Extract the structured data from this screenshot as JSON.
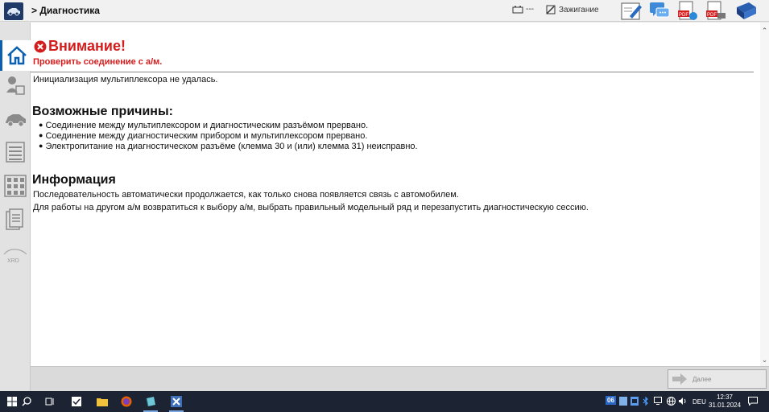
{
  "header": {
    "breadcrumb": "> Диагностика",
    "connection_value": "---",
    "ignition_label": "Зажигание"
  },
  "alert": {
    "title": "Внимание!",
    "subtitle": "Проверить соединение с а/м.",
    "message": "Инициализация мультиплексора не удалась."
  },
  "causes": {
    "heading": "Возможные причины:",
    "items": [
      "Соединение между мультиплексором и диагностическим разъёмом прервано.",
      "Соединение между диагностическим прибором и мультиплексором прервано.",
      "Электропитание на диагностическом разъёме (клемма 30 и (или) клемма 31) неисправно."
    ]
  },
  "info": {
    "heading": "Информация",
    "lines": [
      "Последовательность автоматически продолжается, как только снова появляется связь с автомобилем.",
      "Для работы на другом а/м возвратиться к выбору а/м, выбрать правильный модельный ряд и перезапустить диагностическую сессию."
    ]
  },
  "sidebar": {
    "xrd_label": "XRD"
  },
  "footer": {
    "next_label": "Далее"
  },
  "taskbar": {
    "tray_badge": "06",
    "language": "DEU",
    "time": "12:37",
    "date": "31.01.2024"
  },
  "colors": {
    "alert_red": "#d51c1c",
    "accent_blue": "#0b60b0",
    "taskbar": "#1c2433"
  }
}
